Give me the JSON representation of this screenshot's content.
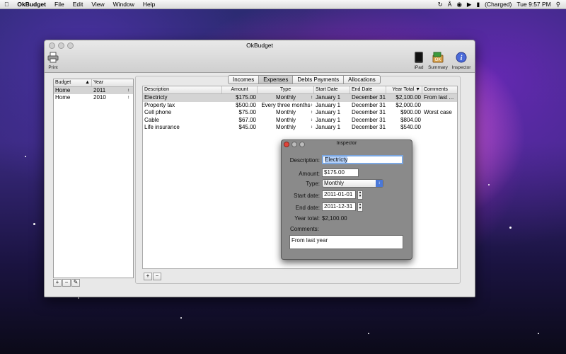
{
  "menubar": {
    "apple": "",
    "app_name": "OkBudget",
    "menus": [
      "File",
      "Edit",
      "View",
      "Window",
      "Help"
    ],
    "battery": "(Charged)",
    "clock": "Tue 9:57 PM"
  },
  "window": {
    "title": "OkBudget",
    "toolbar": {
      "print": "Print",
      "ipad": "iPad",
      "summary": "Summary",
      "inspector": "Inspector",
      "summary_badge": "OK"
    }
  },
  "budgets": {
    "headers": [
      "Budget",
      "Year"
    ],
    "rows": [
      {
        "budget": "Home",
        "year": "2011"
      },
      {
        "budget": "Home",
        "year": "2010"
      }
    ],
    "buttons": [
      "+",
      "−",
      "✎"
    ]
  },
  "tabs": {
    "items": [
      "Incomes",
      "Expenses",
      "Debts Payments",
      "Allocations"
    ],
    "active": "Expenses"
  },
  "expenses": {
    "headers": [
      "Description",
      "Amount",
      "Type",
      "Start Date",
      "End Date",
      "Year Total",
      "Comments"
    ],
    "rows": [
      {
        "description": "Electricty",
        "amount": "$175.00",
        "type": "Monthly",
        "start": "January 1",
        "end": "December 31",
        "total": "$2,100.00",
        "comments": "From last ..."
      },
      {
        "description": "Property tax",
        "amount": "$500.00",
        "type": "Every three months",
        "start": "January 1",
        "end": "December 31",
        "total": "$2,000.00",
        "comments": ""
      },
      {
        "description": "Cell phone",
        "amount": "$75.00",
        "type": "Monthly",
        "start": "January 1",
        "end": "December 31",
        "total": "$900.00",
        "comments": "Worst case"
      },
      {
        "description": "Cable",
        "amount": "$67.00",
        "type": "Monthly",
        "start": "January 1",
        "end": "December 31",
        "total": "$804.00",
        "comments": ""
      },
      {
        "description": "Life insurance",
        "amount": "$45.00",
        "type": "Monthly",
        "start": "January 1",
        "end": "December 31",
        "total": "$540.00",
        "comments": ""
      }
    ],
    "buttons": [
      "+",
      "−"
    ]
  },
  "inspector": {
    "title": "Inspector",
    "description_label": "Description:",
    "description_value": "Electricty",
    "amount_label": "Amount:",
    "amount_value": "$175.00",
    "type_label": "Type:",
    "type_value": "Monthly",
    "start_label": "Start date:",
    "start_value": "2011-01-01",
    "end_label": "End date:",
    "end_value": "2011-12-31",
    "total_label": "Year total:",
    "total_value": "$2,100.00",
    "comments_label": "Comments:",
    "comments_value": "From last year"
  }
}
